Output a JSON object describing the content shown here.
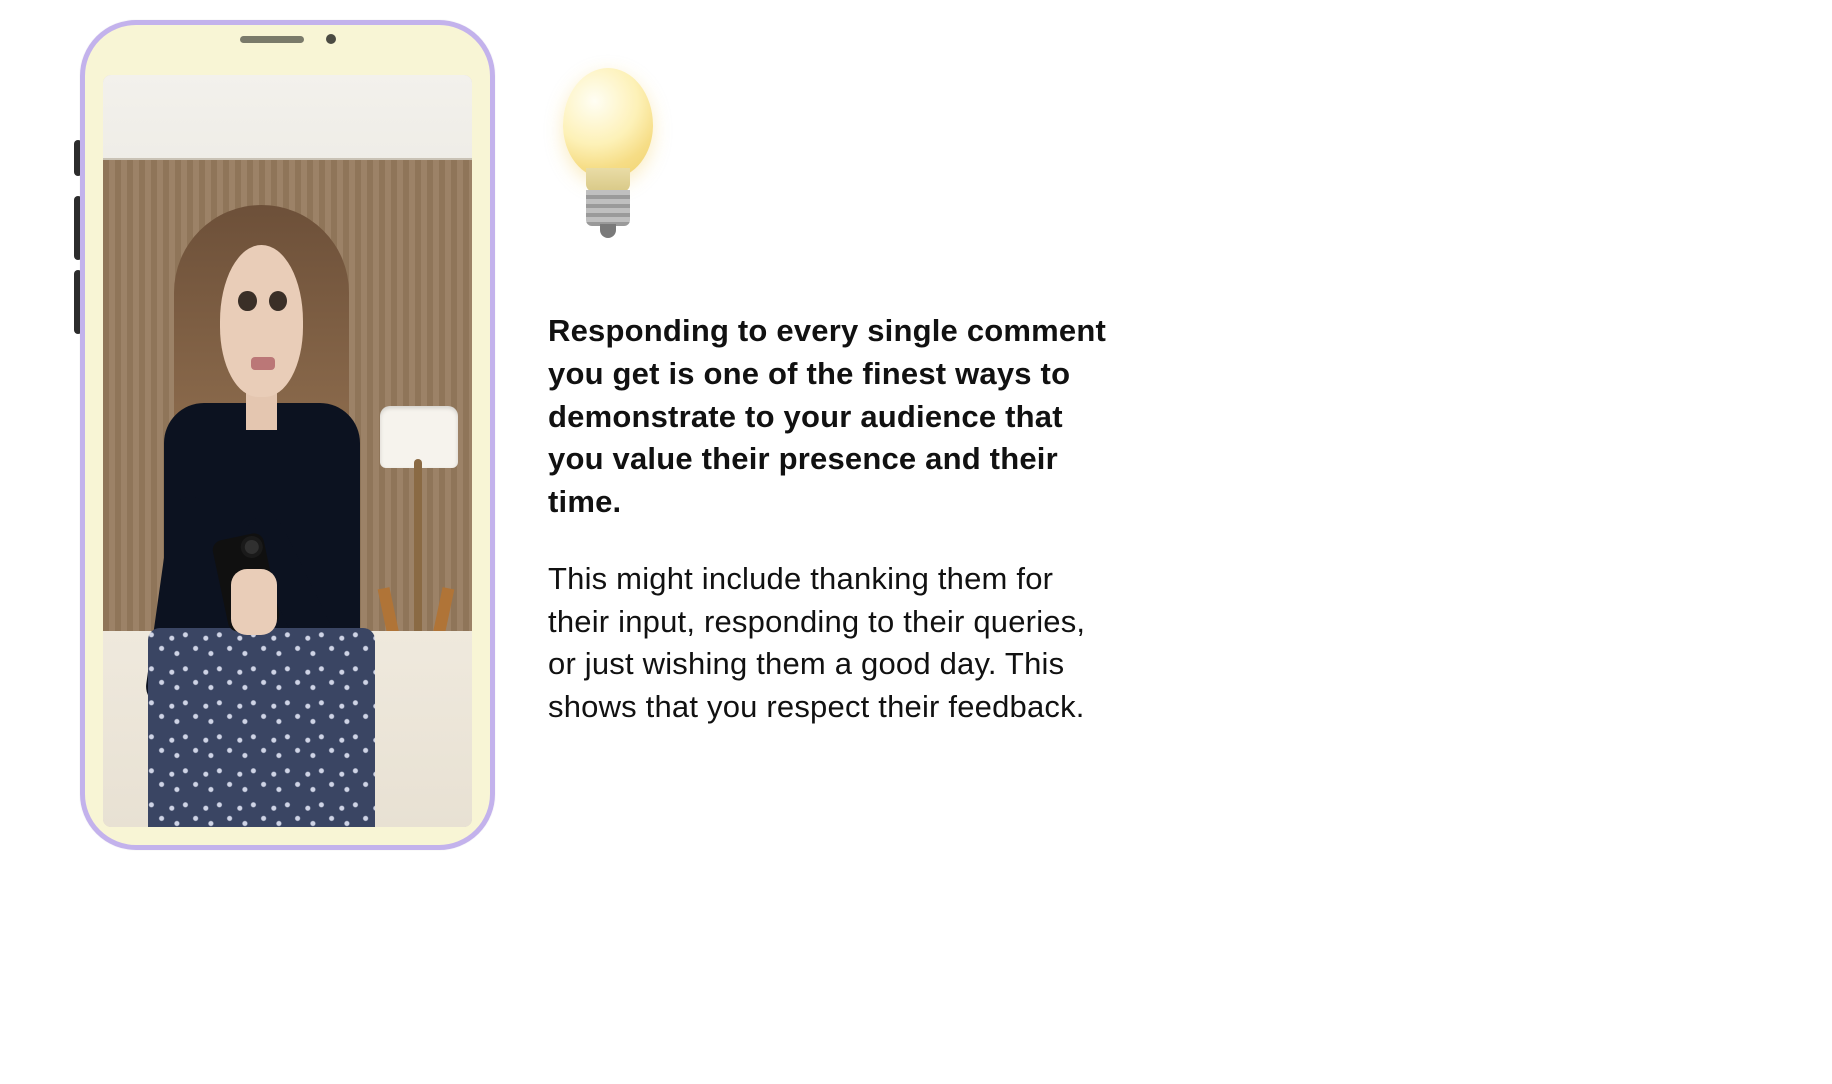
{
  "icon": {
    "name": "lightbulb-icon"
  },
  "tip": {
    "paragraph1": "Responding to every single comment you get is one of the finest ways to demonstrate to your audience that you value their presence and their time.",
    "paragraph2": "This might include thanking them for their input, responding to their queries, or just wishing them a good day. This shows that you respect their feedback."
  },
  "phone": {
    "photo_description": "Woman with long brown hair in a black turtleneck and blue floral skirt taking a mirror selfie with a phone in a hotel room"
  },
  "colors": {
    "phone_border": "#c3b2ec",
    "phone_bezel": "#f8f5d5",
    "text": "#111111",
    "bulb_glow": "#f6dd86"
  }
}
